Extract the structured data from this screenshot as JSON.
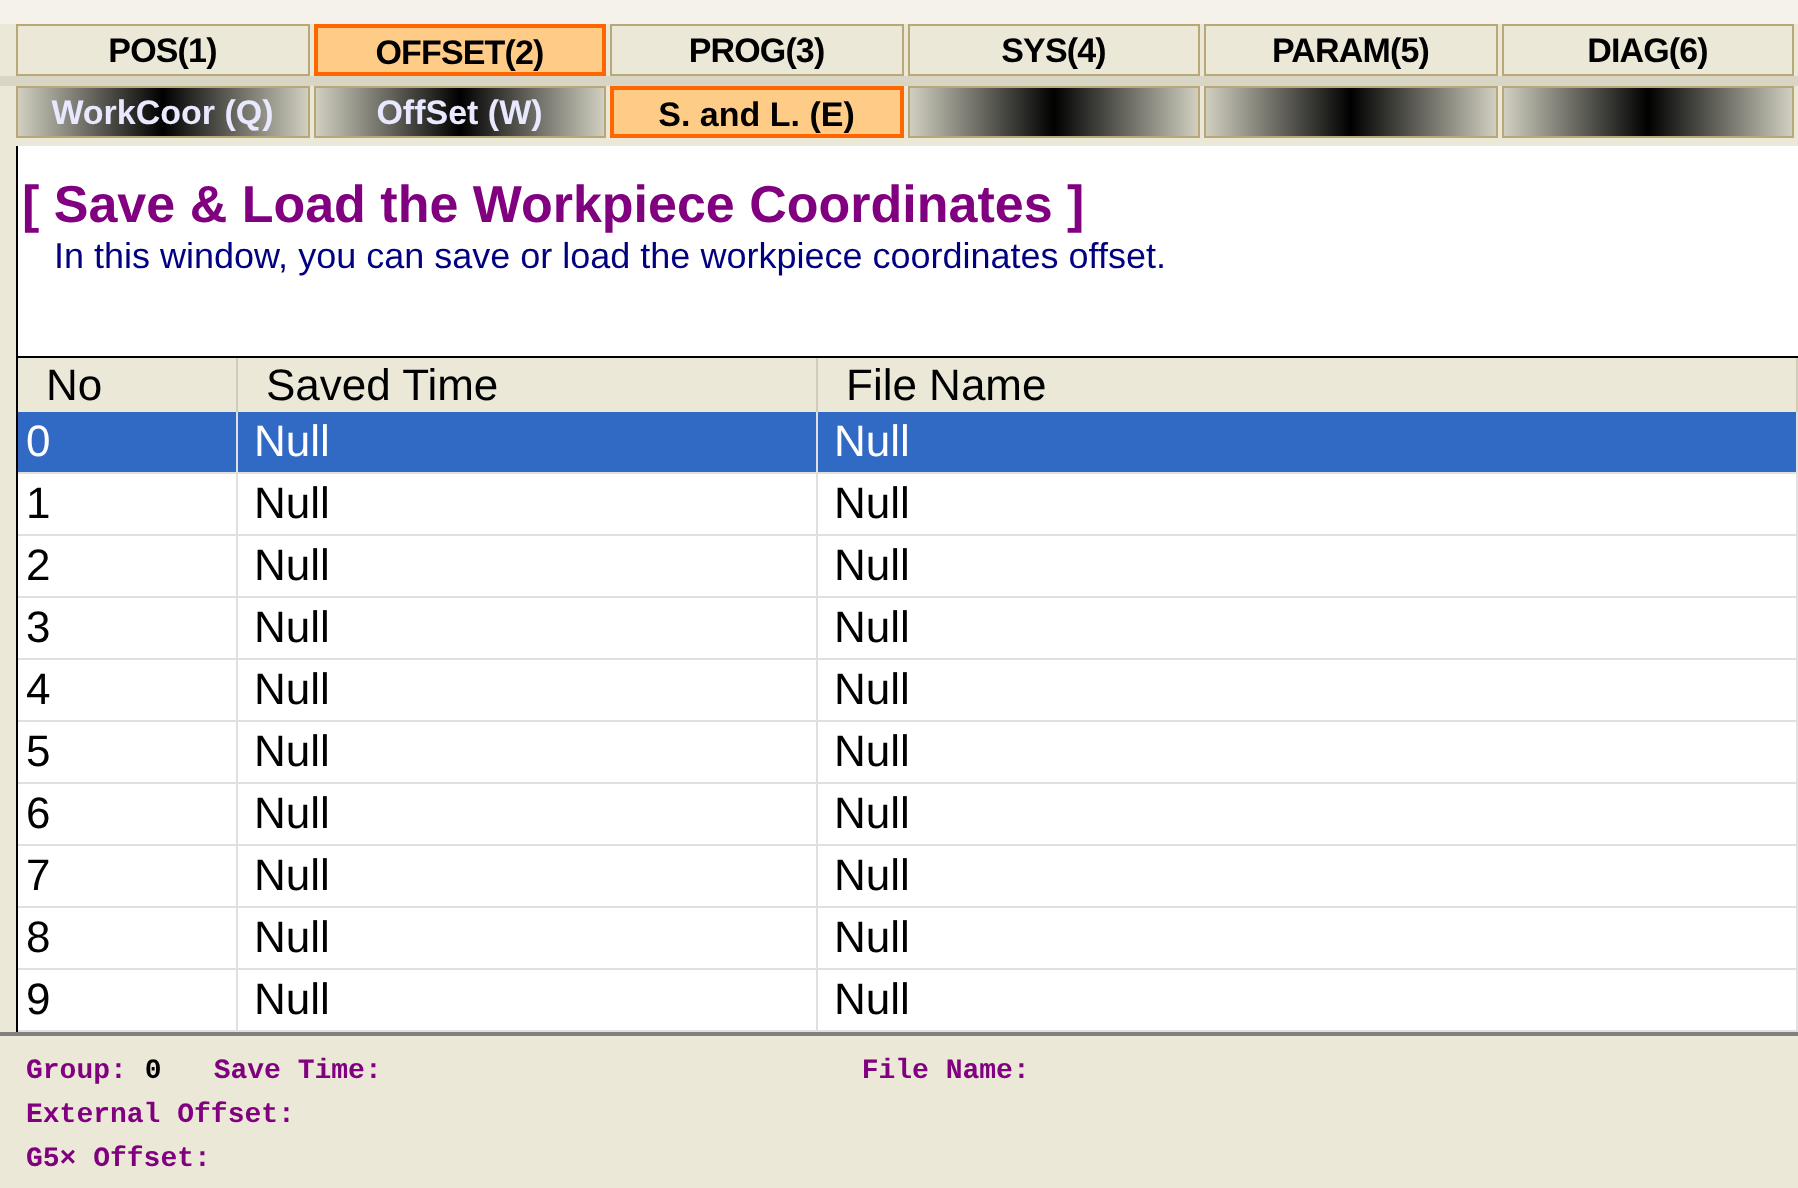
{
  "tabs": [
    {
      "label": "POS(1)",
      "selected": false
    },
    {
      "label": "OFFSET(2)",
      "selected": true
    },
    {
      "label": "PROG(3)",
      "selected": false
    },
    {
      "label": "SYS(4)",
      "selected": false
    },
    {
      "label": "PARAM(5)",
      "selected": false
    },
    {
      "label": "DIAG(6)",
      "selected": false
    }
  ],
  "subtabs": [
    {
      "kind": "labeled",
      "label": "WorkCoor (Q)",
      "selected": false
    },
    {
      "kind": "labeled",
      "label": "OffSet (W)",
      "selected": false
    },
    {
      "kind": "labeled",
      "label": "S. and L. (E)",
      "selected": true
    },
    {
      "kind": "blank"
    },
    {
      "kind": "blank"
    },
    {
      "kind": "blank"
    }
  ],
  "title": "[ Save & Load the Workpiece Coordinates ]",
  "description": "In this window, you can save or load the workpiece coordinates offset.",
  "table": {
    "columns": [
      "No",
      "Saved Time",
      "File Name"
    ],
    "rows": [
      {
        "cells": [
          "0",
          "Null",
          "Null"
        ],
        "selected": true
      },
      {
        "cells": [
          "1",
          "Null",
          "Null"
        ],
        "selected": false
      },
      {
        "cells": [
          "2",
          "Null",
          "Null"
        ],
        "selected": false
      },
      {
        "cells": [
          "3",
          "Null",
          "Null"
        ],
        "selected": false
      },
      {
        "cells": [
          "4",
          "Null",
          "Null"
        ],
        "selected": false
      },
      {
        "cells": [
          "5",
          "Null",
          "Null"
        ],
        "selected": false
      },
      {
        "cells": [
          "6",
          "Null",
          "Null"
        ],
        "selected": false
      },
      {
        "cells": [
          "7",
          "Null",
          "Null"
        ],
        "selected": false
      },
      {
        "cells": [
          "8",
          "Null",
          "Null"
        ],
        "selected": false
      },
      {
        "cells": [
          "9",
          "Null",
          "Null"
        ],
        "selected": false
      }
    ]
  },
  "details": {
    "group_label": "Group:",
    "group_value": "0",
    "save_time_label": "Save Time:",
    "file_name_label": "File Name:",
    "external_offset_label": "External Offset:",
    "g5x_offset_label": "G5× Offset:"
  }
}
